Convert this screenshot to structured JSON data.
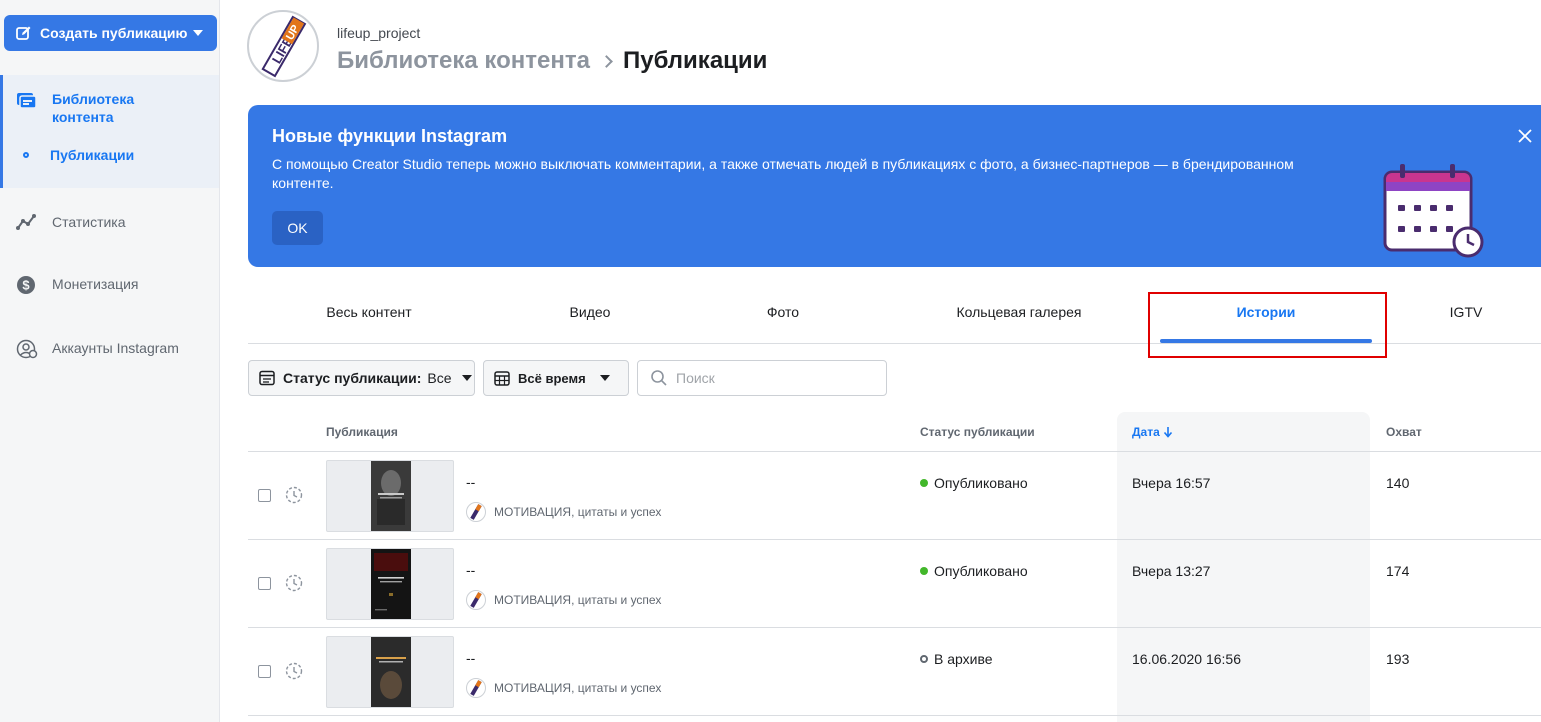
{
  "sidebar": {
    "create_button": "Создать публикацию",
    "items": [
      {
        "label": "Библиотека контента",
        "icon": "content-library-icon"
      },
      {
        "label": "Публикации"
      },
      {
        "label": "Статистика",
        "icon": "insights-icon"
      },
      {
        "label": "Монетизация",
        "icon": "dollar-icon"
      },
      {
        "label": "Аккаунты Instagram",
        "icon": "accounts-gear-icon"
      }
    ]
  },
  "header": {
    "account": "lifeup_project",
    "breadcrumb_parent": "Библиотека контента",
    "breadcrumb_current": "Публикации"
  },
  "banner": {
    "title": "Новые функции Instagram",
    "text": "С помощью Creator Studio теперь можно выключать комментарии, а также отмечать людей в публикациях с фото, а бизнес-партнеров — в брендированном контенте.",
    "ok": "OK"
  },
  "tabs": [
    {
      "label": "Весь контент"
    },
    {
      "label": "Видео"
    },
    {
      "label": "Фото"
    },
    {
      "label": "Кольцевая галерея"
    },
    {
      "label": "Истории",
      "active": true
    },
    {
      "label": "IGTV"
    }
  ],
  "filters": {
    "status_label": "Статус публикации:",
    "status_value": "Все",
    "time": "Всё время",
    "search_placeholder": "Поиск"
  },
  "table": {
    "headers": {
      "publication": "Публикация",
      "status": "Статус публикации",
      "date": "Дата",
      "reach": "Охват"
    },
    "rows": [
      {
        "title": "--",
        "account": "МОТИВАЦИЯ, цитаты и успех",
        "status": "Опубликовано",
        "status_kind": "published",
        "date": "Вчера 16:57",
        "reach": "140"
      },
      {
        "title": "--",
        "account": "МОТИВАЦИЯ, цитаты и успех",
        "status": "Опубликовано",
        "status_kind": "published",
        "date": "Вчера 13:27",
        "reach": "174"
      },
      {
        "title": "--",
        "account": "МОТИВАЦИЯ, цитаты и успех",
        "status": "В архиве",
        "status_kind": "archived",
        "date": "16.06.2020 16:56",
        "reach": "193"
      }
    ]
  },
  "colors": {
    "accent": "#3578e5",
    "link": "#1877f2",
    "published": "#42b72a",
    "highlight": "#e00000"
  }
}
